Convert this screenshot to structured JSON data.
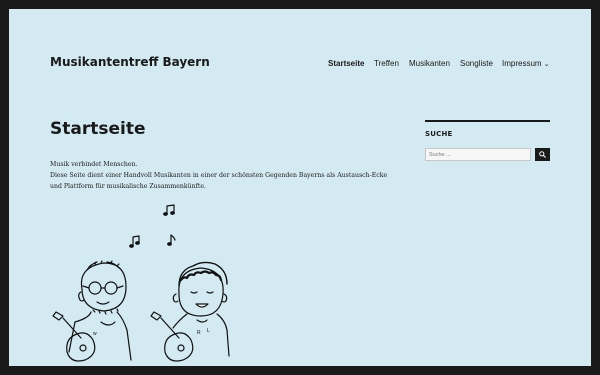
{
  "site": {
    "title": "Musikantentreff Bayern"
  },
  "nav": {
    "items": [
      {
        "label": "Startseite",
        "current": true
      },
      {
        "label": "Treffen",
        "current": false
      },
      {
        "label": "Musikanten",
        "current": false
      },
      {
        "label": "Songliste",
        "current": false
      },
      {
        "label": "Impressum",
        "current": false,
        "dropdown_icon": "chevron-down-icon"
      }
    ]
  },
  "page": {
    "title": "Startseite",
    "paragraph_line1": "Musik verbindet Menschen.",
    "paragraph_line2": "Diese Seite dient einer Handvoll Musikanten in einer der schönsten Gegenden Bayerns als Austausch-Ecke",
    "paragraph_line3": "und Plattform für musikalische Zusammenkünfte."
  },
  "sidebar": {
    "search_heading": "SUCHE",
    "search_placeholder": "Suche ...",
    "search_button_icon": "search-icon"
  },
  "illustration": {
    "description_icons": [
      "music-note-icon",
      "musician-with-glasses",
      "musician-curly-hair",
      "ukulele"
    ]
  },
  "colors": {
    "background": "#d4eaf2",
    "frame": "#1a1a1a",
    "text": "#1a1a1a"
  }
}
